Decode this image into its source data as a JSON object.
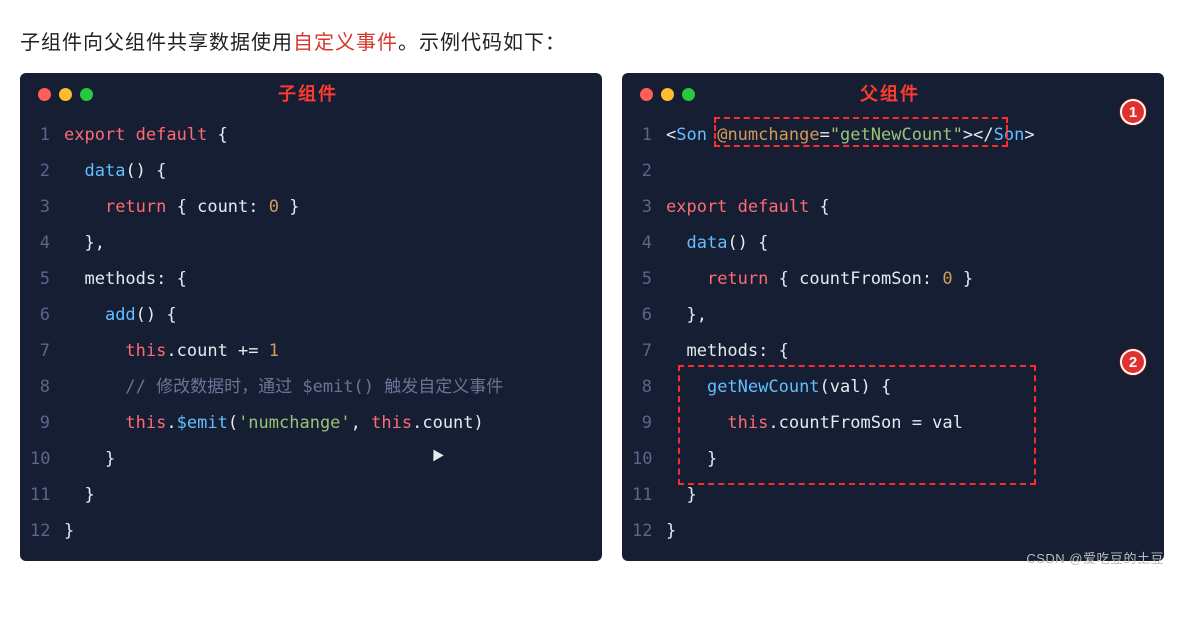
{
  "heading_pre": "子组件向父组件共享数据使用",
  "heading_red": "自定义事件",
  "heading_post": "。示例代码如下：",
  "watermark": "CSDN @爱吃豆的土豆",
  "leftTitle": "子组件",
  "rightTitle": "父组件",
  "left": {
    "lines": [
      {
        "n": "1",
        "seg": [
          [
            "kw",
            "export "
          ],
          [
            "kw",
            "default "
          ],
          [
            "pl",
            "{"
          ]
        ]
      },
      {
        "n": "2",
        "seg": [
          [
            "pl",
            "  "
          ],
          [
            "fn",
            "data"
          ],
          [
            "pl",
            "() {"
          ]
        ]
      },
      {
        "n": "3",
        "seg": [
          [
            "pl",
            "    "
          ],
          [
            "kw",
            "return"
          ],
          [
            "pl",
            " { "
          ],
          [
            "prop",
            "count"
          ],
          [
            "pl",
            ": "
          ],
          [
            "num",
            "0"
          ],
          [
            "pl",
            " }"
          ]
        ]
      },
      {
        "n": "4",
        "seg": [
          [
            "pl",
            "  },"
          ]
        ]
      },
      {
        "n": "5",
        "seg": [
          [
            "pl",
            "  "
          ],
          [
            "prop",
            "methods"
          ],
          [
            "pl",
            ": {"
          ]
        ]
      },
      {
        "n": "6",
        "seg": [
          [
            "pl",
            "    "
          ],
          [
            "fn",
            "add"
          ],
          [
            "pl",
            "() {"
          ]
        ]
      },
      {
        "n": "7",
        "seg": [
          [
            "pl",
            "      "
          ],
          [
            "kw",
            "this"
          ],
          [
            "pl",
            "."
          ],
          [
            "prop",
            "count"
          ],
          [
            "pl",
            " += "
          ],
          [
            "num",
            "1"
          ]
        ]
      },
      {
        "n": "8",
        "seg": [
          [
            "pl",
            "      "
          ],
          [
            "com",
            "// 修改数据时，通过 $emit() 触发自定义事件"
          ]
        ]
      },
      {
        "n": "9",
        "seg": [
          [
            "pl",
            "      "
          ],
          [
            "kw",
            "this"
          ],
          [
            "pl",
            "."
          ],
          [
            "emit",
            "$emit"
          ],
          [
            "pl",
            "("
          ],
          [
            "str",
            "'numchange'"
          ],
          [
            "pl",
            ", "
          ],
          [
            "kw",
            "this"
          ],
          [
            "pl",
            "."
          ],
          [
            "prop",
            "count"
          ],
          [
            "pl",
            ")"
          ]
        ]
      },
      {
        "n": "10",
        "seg": [
          [
            "pl",
            "    }"
          ]
        ]
      },
      {
        "n": "11",
        "seg": [
          [
            "pl",
            "  }"
          ]
        ]
      },
      {
        "n": "12",
        "seg": [
          [
            "pl",
            "}"
          ]
        ]
      }
    ]
  },
  "right": {
    "lines": [
      {
        "n": "1",
        "seg": [
          [
            "pl",
            "<"
          ],
          [
            "tag",
            "Son "
          ],
          [
            "attr",
            "@numchange"
          ],
          [
            "pl",
            "="
          ],
          [
            "str",
            "\"getNewCount\""
          ],
          [
            "pl",
            "></"
          ],
          [
            "tag",
            "Son"
          ],
          [
            "pl",
            ">"
          ]
        ]
      },
      {
        "n": "2",
        "seg": [
          [
            "pl",
            ""
          ]
        ]
      },
      {
        "n": "3",
        "seg": [
          [
            "kw",
            "export "
          ],
          [
            "kw",
            "default "
          ],
          [
            "pl",
            "{"
          ]
        ]
      },
      {
        "n": "4",
        "seg": [
          [
            "pl",
            "  "
          ],
          [
            "fn",
            "data"
          ],
          [
            "pl",
            "() {"
          ]
        ]
      },
      {
        "n": "5",
        "seg": [
          [
            "pl",
            "    "
          ],
          [
            "kw",
            "return"
          ],
          [
            "pl",
            " { "
          ],
          [
            "prop",
            "countFromSon"
          ],
          [
            "pl",
            ": "
          ],
          [
            "num",
            "0"
          ],
          [
            "pl",
            " }"
          ]
        ]
      },
      {
        "n": "6",
        "seg": [
          [
            "pl",
            "  },"
          ]
        ]
      },
      {
        "n": "7",
        "seg": [
          [
            "pl",
            "  "
          ],
          [
            "prop",
            "methods"
          ],
          [
            "pl",
            ": {"
          ]
        ]
      },
      {
        "n": "8",
        "seg": [
          [
            "pl",
            "    "
          ],
          [
            "fn",
            "getNewCount"
          ],
          [
            "pl",
            "("
          ],
          [
            "id",
            "val"
          ],
          [
            "pl",
            ") {"
          ]
        ]
      },
      {
        "n": "9",
        "seg": [
          [
            "pl",
            "      "
          ],
          [
            "kw",
            "this"
          ],
          [
            "pl",
            "."
          ],
          [
            "prop",
            "countFromSon"
          ],
          [
            "pl",
            " = "
          ],
          [
            "id",
            "val"
          ]
        ]
      },
      {
        "n": "10",
        "seg": [
          [
            "pl",
            "    }"
          ]
        ]
      },
      {
        "n": "11",
        "seg": [
          [
            "pl",
            "  }"
          ]
        ]
      },
      {
        "n": "12",
        "seg": [
          [
            "pl",
            "}"
          ]
        ]
      }
    ],
    "callouts": {
      "one": "1",
      "two": "2"
    }
  }
}
